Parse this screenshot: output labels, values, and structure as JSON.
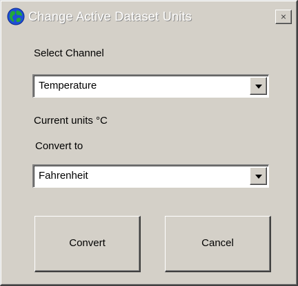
{
  "window": {
    "title": "Change Active Dataset Units",
    "close_glyph": "×"
  },
  "channel": {
    "label": "Select Channel",
    "selected": "Temperature"
  },
  "units": {
    "current_text": "Current units °C"
  },
  "convert": {
    "label": "Convert to",
    "selected": "Fahrenheit"
  },
  "buttons": {
    "convert_label": "Convert",
    "cancel_label": "Cancel"
  },
  "icons": {
    "app": "globe-icon",
    "dropdown": "chevron-down-icon",
    "close": "close-icon"
  },
  "colors": {
    "face": "#d4d0c8",
    "field": "#ffffff",
    "globe_ocean": "#1f4fd6",
    "globe_land": "#22a83a"
  }
}
